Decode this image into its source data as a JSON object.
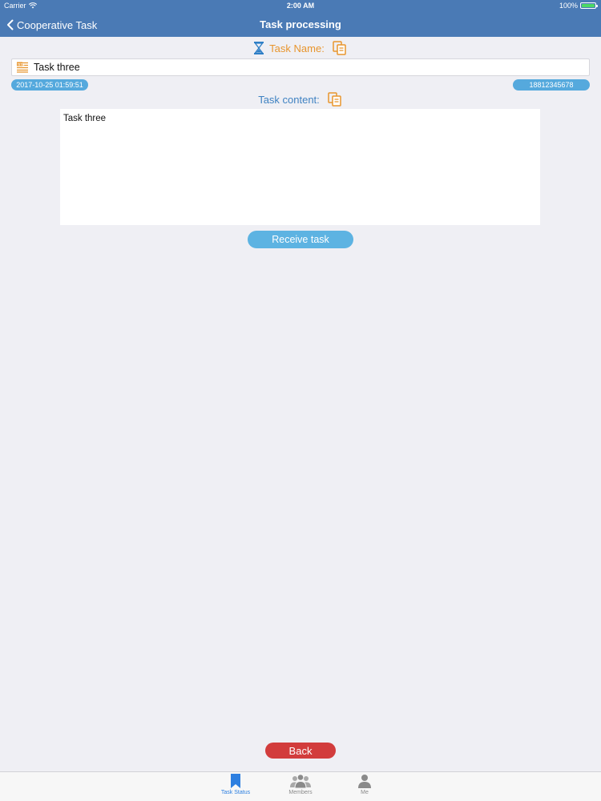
{
  "status_bar": {
    "carrier": "Carrier",
    "time": "2:00 AM",
    "battery": "100%"
  },
  "nav": {
    "back_label": "Cooperative Task",
    "title": "Task processing"
  },
  "task_name": {
    "label": "Task Name:",
    "value": "Task three"
  },
  "meta": {
    "date": "2017-10-25 01:59:51",
    "phone": "18812345678"
  },
  "task_content": {
    "label": "Task content:",
    "value": "Task three"
  },
  "buttons": {
    "receive": "Receive task",
    "back": "Back"
  },
  "tabs": [
    {
      "label": "Task Status",
      "icon": "bookmark-icon",
      "active": true
    },
    {
      "label": "Members",
      "icon": "members-icon",
      "active": false
    },
    {
      "label": "Me",
      "icon": "person-icon",
      "active": false
    }
  ],
  "colors": {
    "nav_bar": "#4a7ab5",
    "task_name_label": "#e8952d",
    "task_content_label": "#3f82c2",
    "pill": "#55a9dd",
    "receive_button": "#5db3e2",
    "back_button": "#d23c3c",
    "tab_active": "#2d7fe0"
  }
}
